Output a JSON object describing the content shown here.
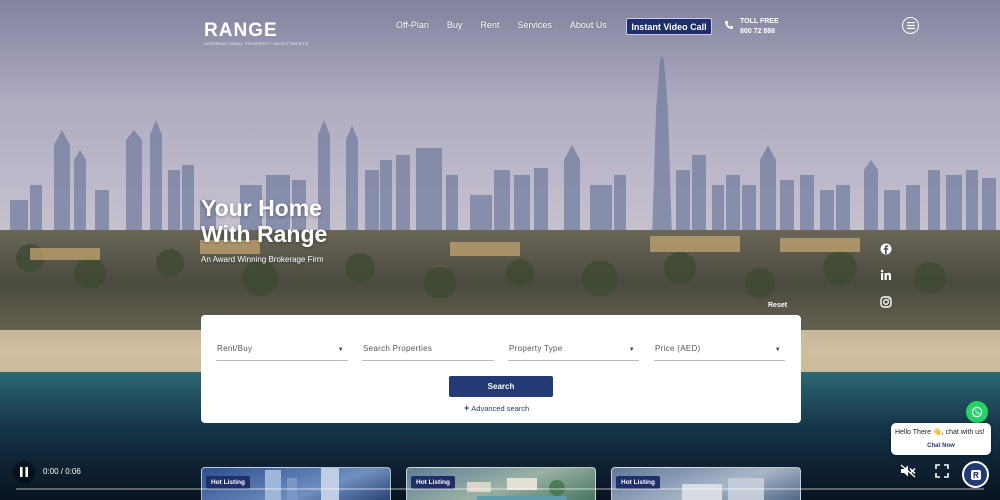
{
  "header": {
    "logo_word": "RANGE",
    "logo_tagline": "INTERNATIONAL PROPERTY INVESTMENTS",
    "nav": [
      "Off-Plan",
      "Buy",
      "Rent",
      "Services",
      "About Us"
    ],
    "video_call_label": "Instant Video Call",
    "toll_free_label": "TOLL FREE",
    "toll_free_number": "800 72 888"
  },
  "hero": {
    "title_line1": "Your Home",
    "title_line2": "With Range",
    "subtitle": "An Award Winning Brokerage Firm"
  },
  "search": {
    "reset_label": "Reset",
    "fields": [
      "Rent/Buy",
      "Search Properties",
      "Property Type",
      "Price (AED)"
    ],
    "button_label": "Search",
    "advanced_label": "Advanced search"
  },
  "video": {
    "time": "0:00 / 0:06",
    "progress": 0.0
  },
  "listings": [
    {
      "badge": "Hot Listing"
    },
    {
      "badge": "Hot Listing"
    },
    {
      "badge": "Hot Listing"
    }
  ],
  "chat": {
    "greeting": "Hello There 👋, chat with us!",
    "cta": "Chat Now"
  },
  "icons": {
    "social": [
      "facebook-icon",
      "linkedin-icon",
      "instagram-icon"
    ],
    "whatsapp_color": "#25d366",
    "brand_color": "#1f2f6b"
  }
}
